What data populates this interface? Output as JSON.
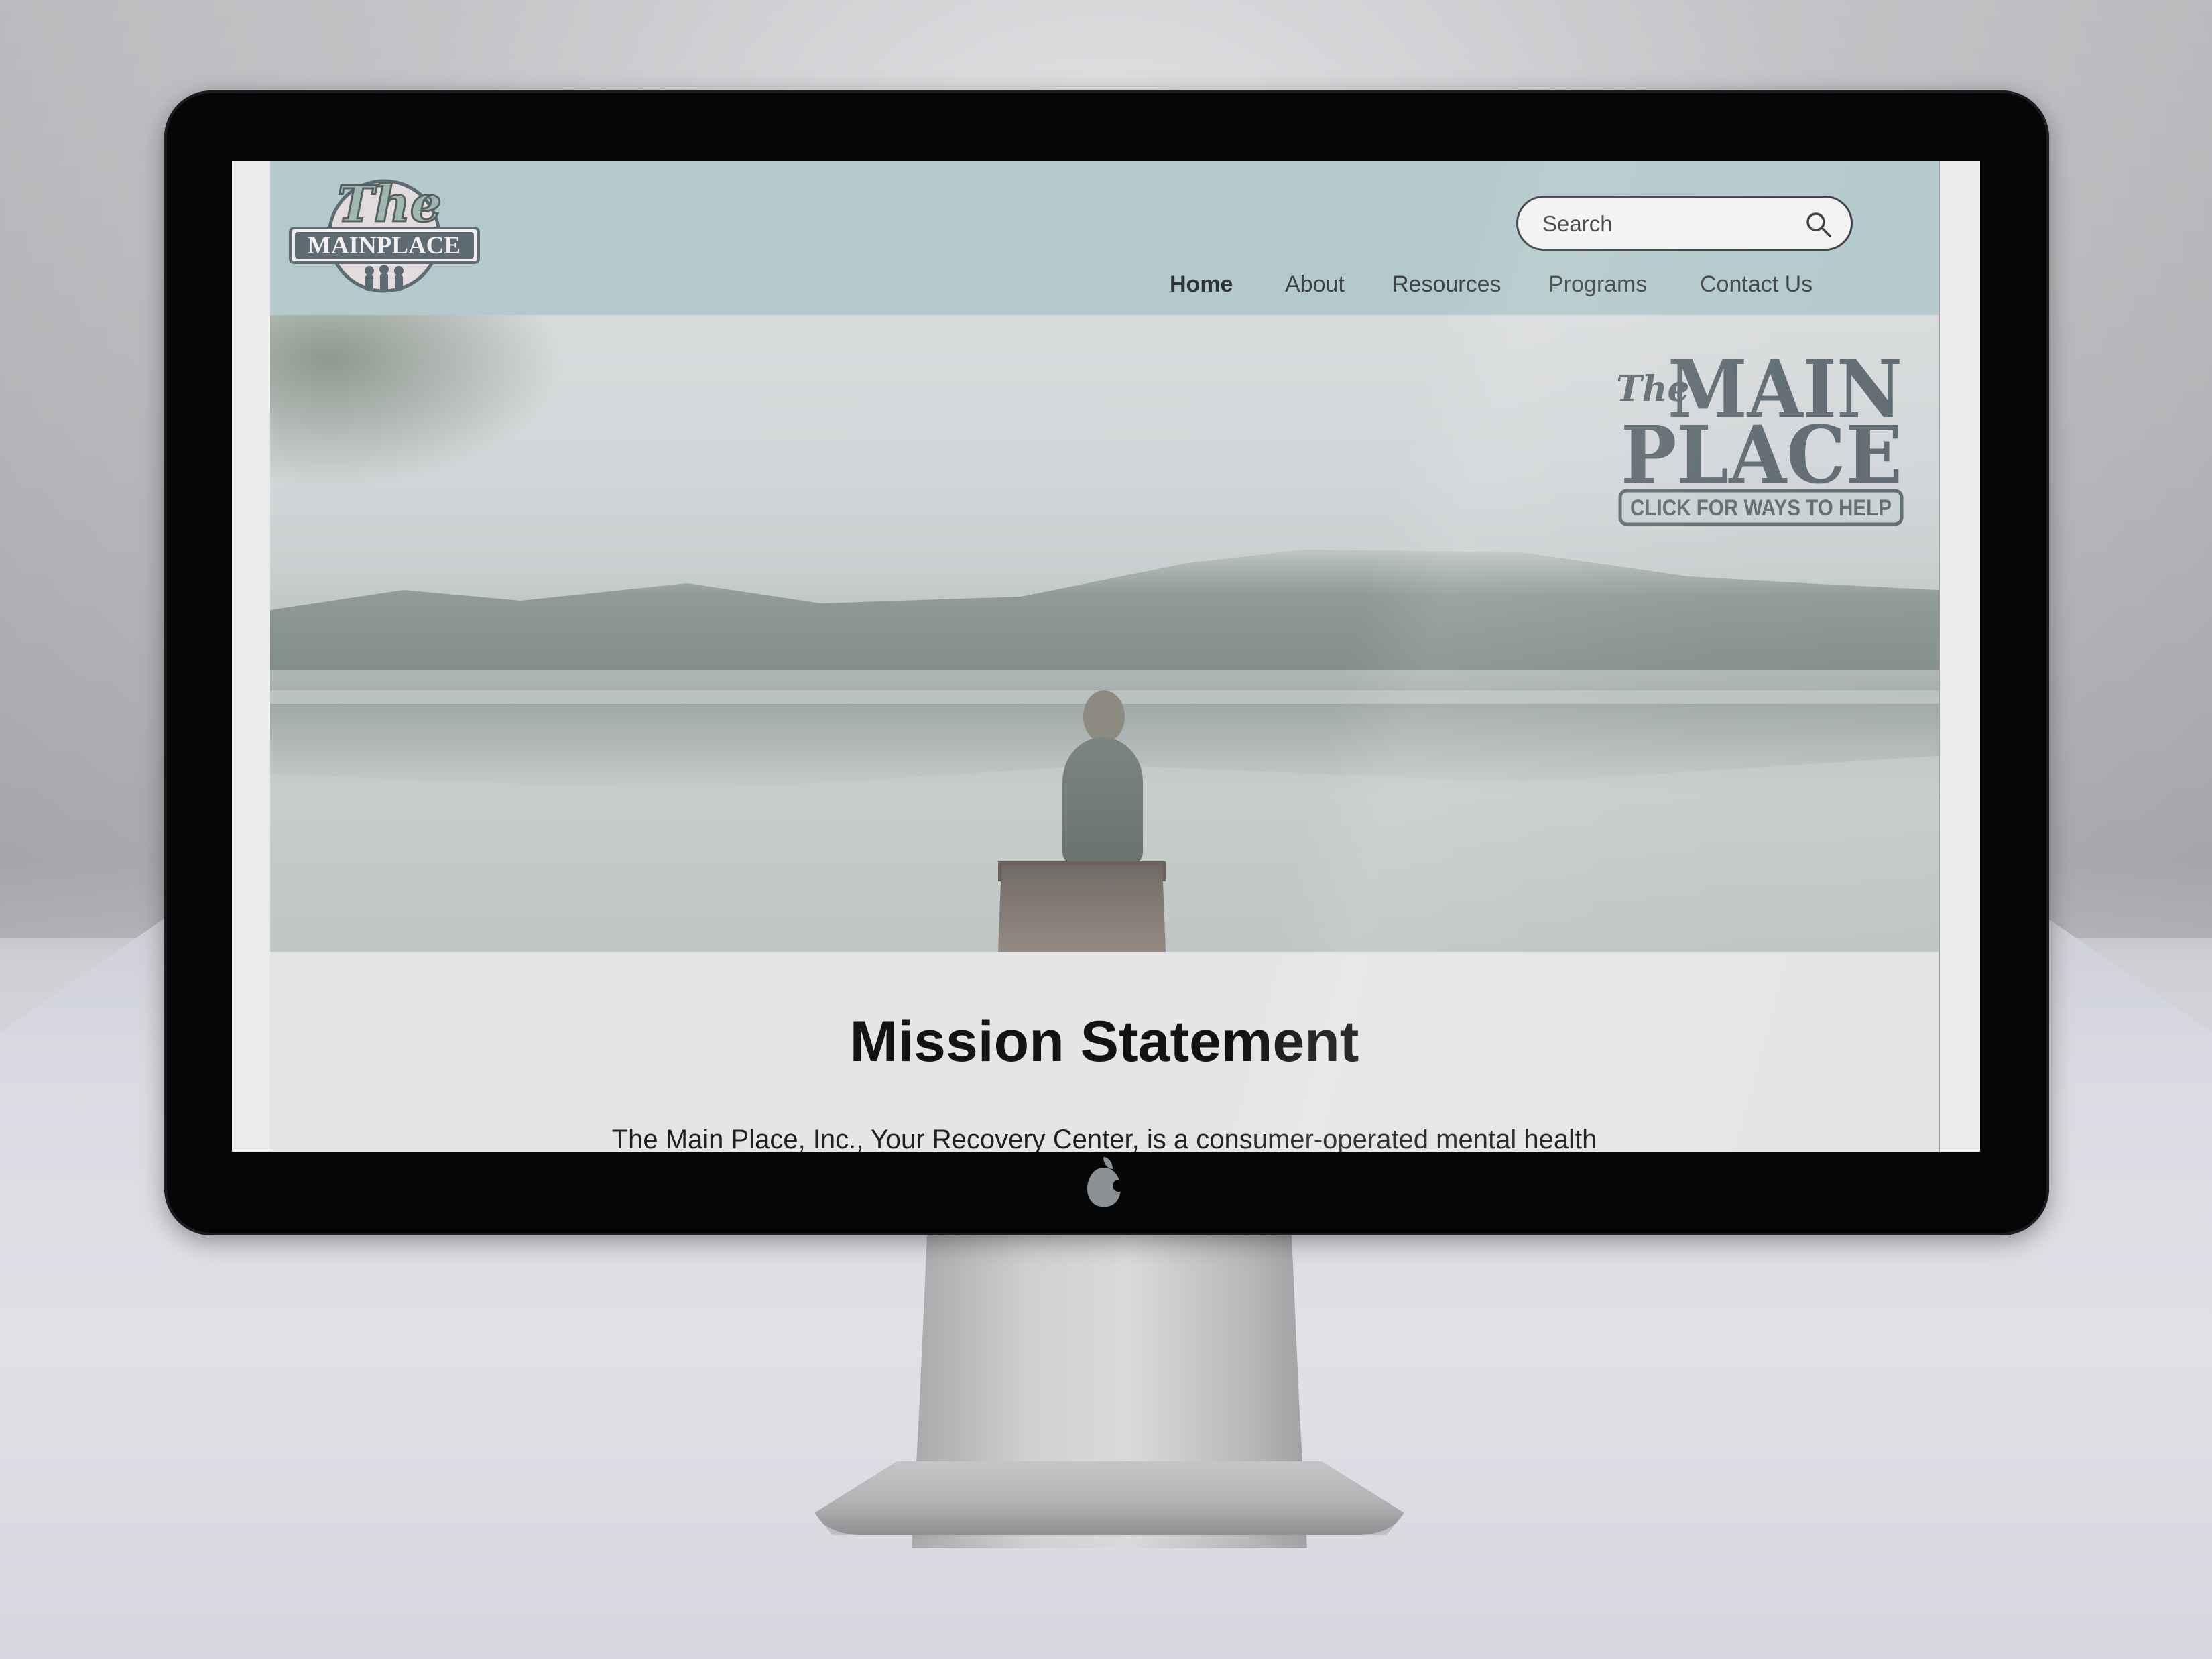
{
  "header": {
    "logo_text": "The MAINPLACE",
    "search": {
      "placeholder": "Search"
    },
    "nav": [
      {
        "label": "Home",
        "active": true
      },
      {
        "label": "About"
      },
      {
        "label": "Resources"
      },
      {
        "label": "Programs"
      },
      {
        "label": "Contact Us"
      }
    ]
  },
  "hero": {
    "cta_the": "The",
    "cta_main": "MAIN",
    "cta_place": "PLACE",
    "cta_help": "CLICK FOR WAYS TO HELP"
  },
  "mission": {
    "title": "Mission Statement",
    "text": "The Main Place, Inc., Your Recovery Center, is a consumer-operated mental health"
  },
  "colors": {
    "header_bg": "#b3c9cb",
    "logo_color": "#5f6b72",
    "text_dark": "#121314"
  },
  "icons": [
    "search-icon",
    "apple-logo-icon"
  ]
}
